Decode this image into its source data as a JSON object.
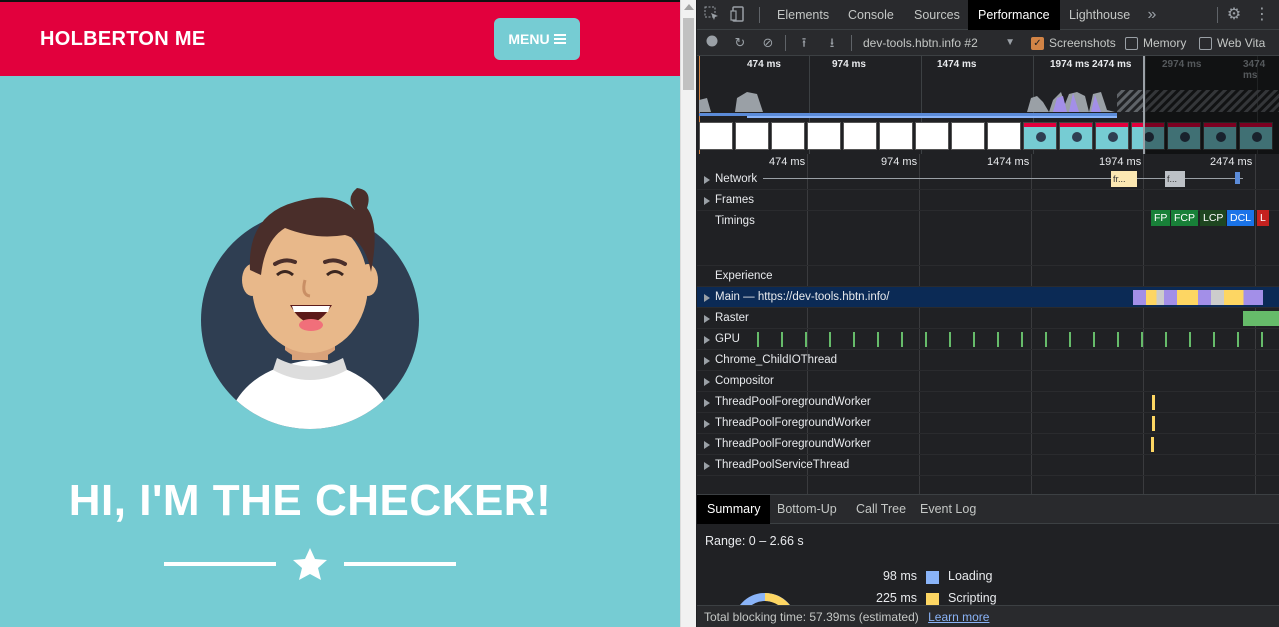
{
  "page": {
    "brand": "HOLBERTON ME",
    "menu_label": "MENU",
    "hero_title": "HI, I'M THE CHECKER!",
    "colors": {
      "nav": "#E2003D",
      "background": "#76CCD3",
      "avatar_circle": "#2F3E52"
    }
  },
  "devtools": {
    "tabs": [
      "Elements",
      "Console",
      "Sources",
      "Performance",
      "Lighthouse"
    ],
    "active_tab": "Performance",
    "more_tabs_icon": "chevron-double-right-icon",
    "toolbar": {
      "target": "dev-tools.hbtn.info #2",
      "checkboxes": [
        {
          "label": "Screenshots",
          "checked": true
        },
        {
          "label": "Memory",
          "checked": false
        },
        {
          "label": "Web Vita",
          "checked": false
        }
      ]
    },
    "overview_ticks": [
      "474 ms",
      "974 ms",
      "1474 ms",
      "1974 ms",
      "2474 ms",
      "2974 ms",
      "3474 ms"
    ],
    "flame_ticks": [
      "474 ms",
      "974 ms",
      "1474 ms",
      "1974 ms",
      "2474 ms"
    ],
    "tracks": [
      {
        "label": "Network",
        "expandable": true
      },
      {
        "label": "Frames",
        "expandable": true
      },
      {
        "label": "Timings",
        "expandable": false
      },
      {
        "label": "",
        "expandable": false
      },
      {
        "label": "Experience",
        "expandable": false
      },
      {
        "label": "Main — https://dev-tools.hbtn.info/",
        "expandable": true,
        "selected": true
      },
      {
        "label": "Raster",
        "expandable": true
      },
      {
        "label": "GPU",
        "expandable": true
      },
      {
        "label": "Chrome_ChildIOThread",
        "expandable": true
      },
      {
        "label": "Compositor",
        "expandable": true
      },
      {
        "label": "ThreadPoolForegroundWorker",
        "expandable": true
      },
      {
        "label": "ThreadPoolForegroundWorker",
        "expandable": true
      },
      {
        "label": "ThreadPoolForegroundWorker",
        "expandable": true
      },
      {
        "label": "ThreadPoolServiceThread",
        "expandable": true
      }
    ],
    "network_chip": "fr...",
    "network_chip2": "f...",
    "timings": [
      {
        "label": "FP",
        "color": "#188038"
      },
      {
        "label": "FCP",
        "color": "#188038"
      },
      {
        "label": "LCP",
        "color": "#1E4620"
      },
      {
        "label": "DCL",
        "color": "#1A73E8"
      },
      {
        "label": "L",
        "color": "#C5221F"
      }
    ],
    "bottom_tabs": [
      "Summary",
      "Bottom-Up",
      "Call Tree",
      "Event Log"
    ],
    "active_bottom_tab": "Summary",
    "range": "Range: 0 – 2.66 s",
    "summary": [
      {
        "value": "98 ms",
        "label": "Loading",
        "color": "#8AB4F8"
      },
      {
        "value": "225 ms",
        "label": "Scripting",
        "color": "#FDD663"
      }
    ],
    "status_text": "Total blocking time: 57.39ms (estimated)",
    "learn_more": "Learn more"
  }
}
